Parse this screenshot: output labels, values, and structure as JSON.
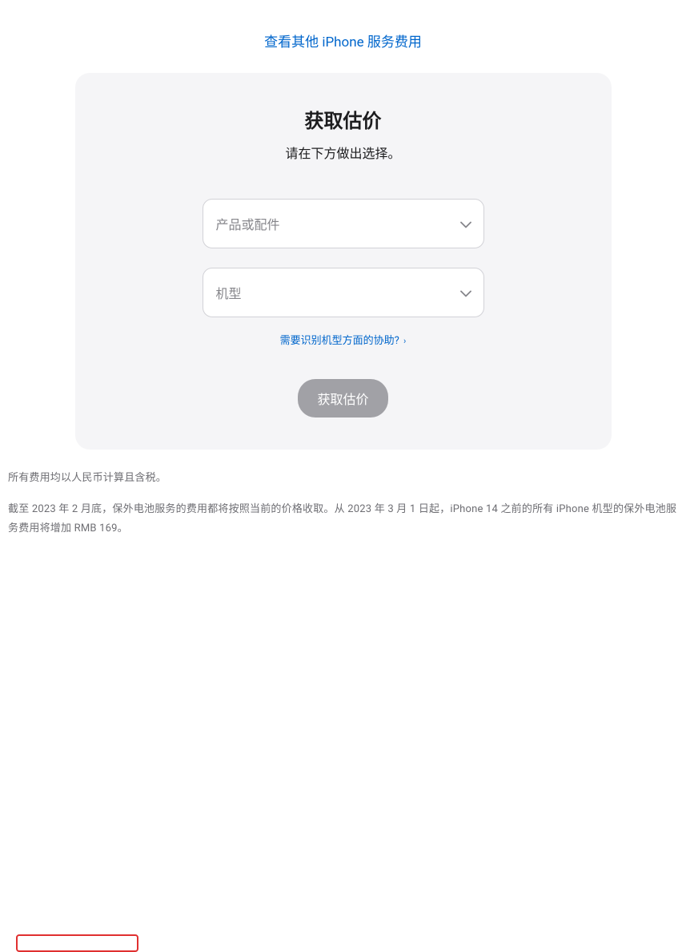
{
  "topLink": {
    "label": "查看其他 iPhone 服务费用"
  },
  "card": {
    "title": "获取估价",
    "subtitle": "请在下方做出选择。",
    "select1": {
      "placeholder": "产品或配件"
    },
    "select2": {
      "placeholder": "机型"
    },
    "helpLink": {
      "label": "需要识别机型方面的协助?"
    },
    "button": {
      "label": "获取估价"
    }
  },
  "footer": {
    "line1": "所有费用均以人民币计算且含税。",
    "line2": "截至 2023 年 2 月底，保外电池服务的费用都将按照当前的价格收取。从 2023 年 3 月 1 日起，iPhone 14 之前的所有 iPhone 机型的保外电池服务费用将增加 RMB 169。"
  }
}
